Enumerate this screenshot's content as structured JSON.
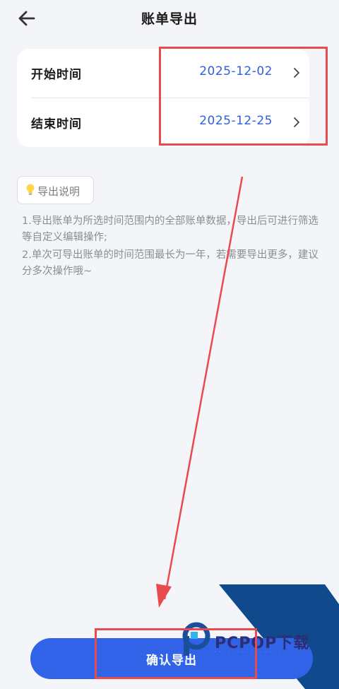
{
  "header": {
    "title": "账单导出",
    "back_icon": "arrow-left-icon"
  },
  "date_card": {
    "start": {
      "label": "开始时间",
      "value": "2025-12-02"
    },
    "end": {
      "label": "结束时间",
      "value": "2025-12-25"
    }
  },
  "tips": {
    "badge_label": "导出说明",
    "badge_icon": "lightbulb-icon",
    "items": [
      "1.导出账单为所选时间范围内的全部账单数据，导出后可进行筛选等自定义编辑操作;",
      "2.单次可导出账单的时间范围最长为一年，若需要导出更多，建议分多次操作哦~"
    ]
  },
  "actions": {
    "confirm_label": "确认导出"
  },
  "watermark": {
    "text": "PCPOP下载"
  },
  "colors": {
    "accent": "#3063e8",
    "value_text": "#2f5fe0",
    "annotation_red": "#e84a4f",
    "background": "#f4f5f9"
  }
}
